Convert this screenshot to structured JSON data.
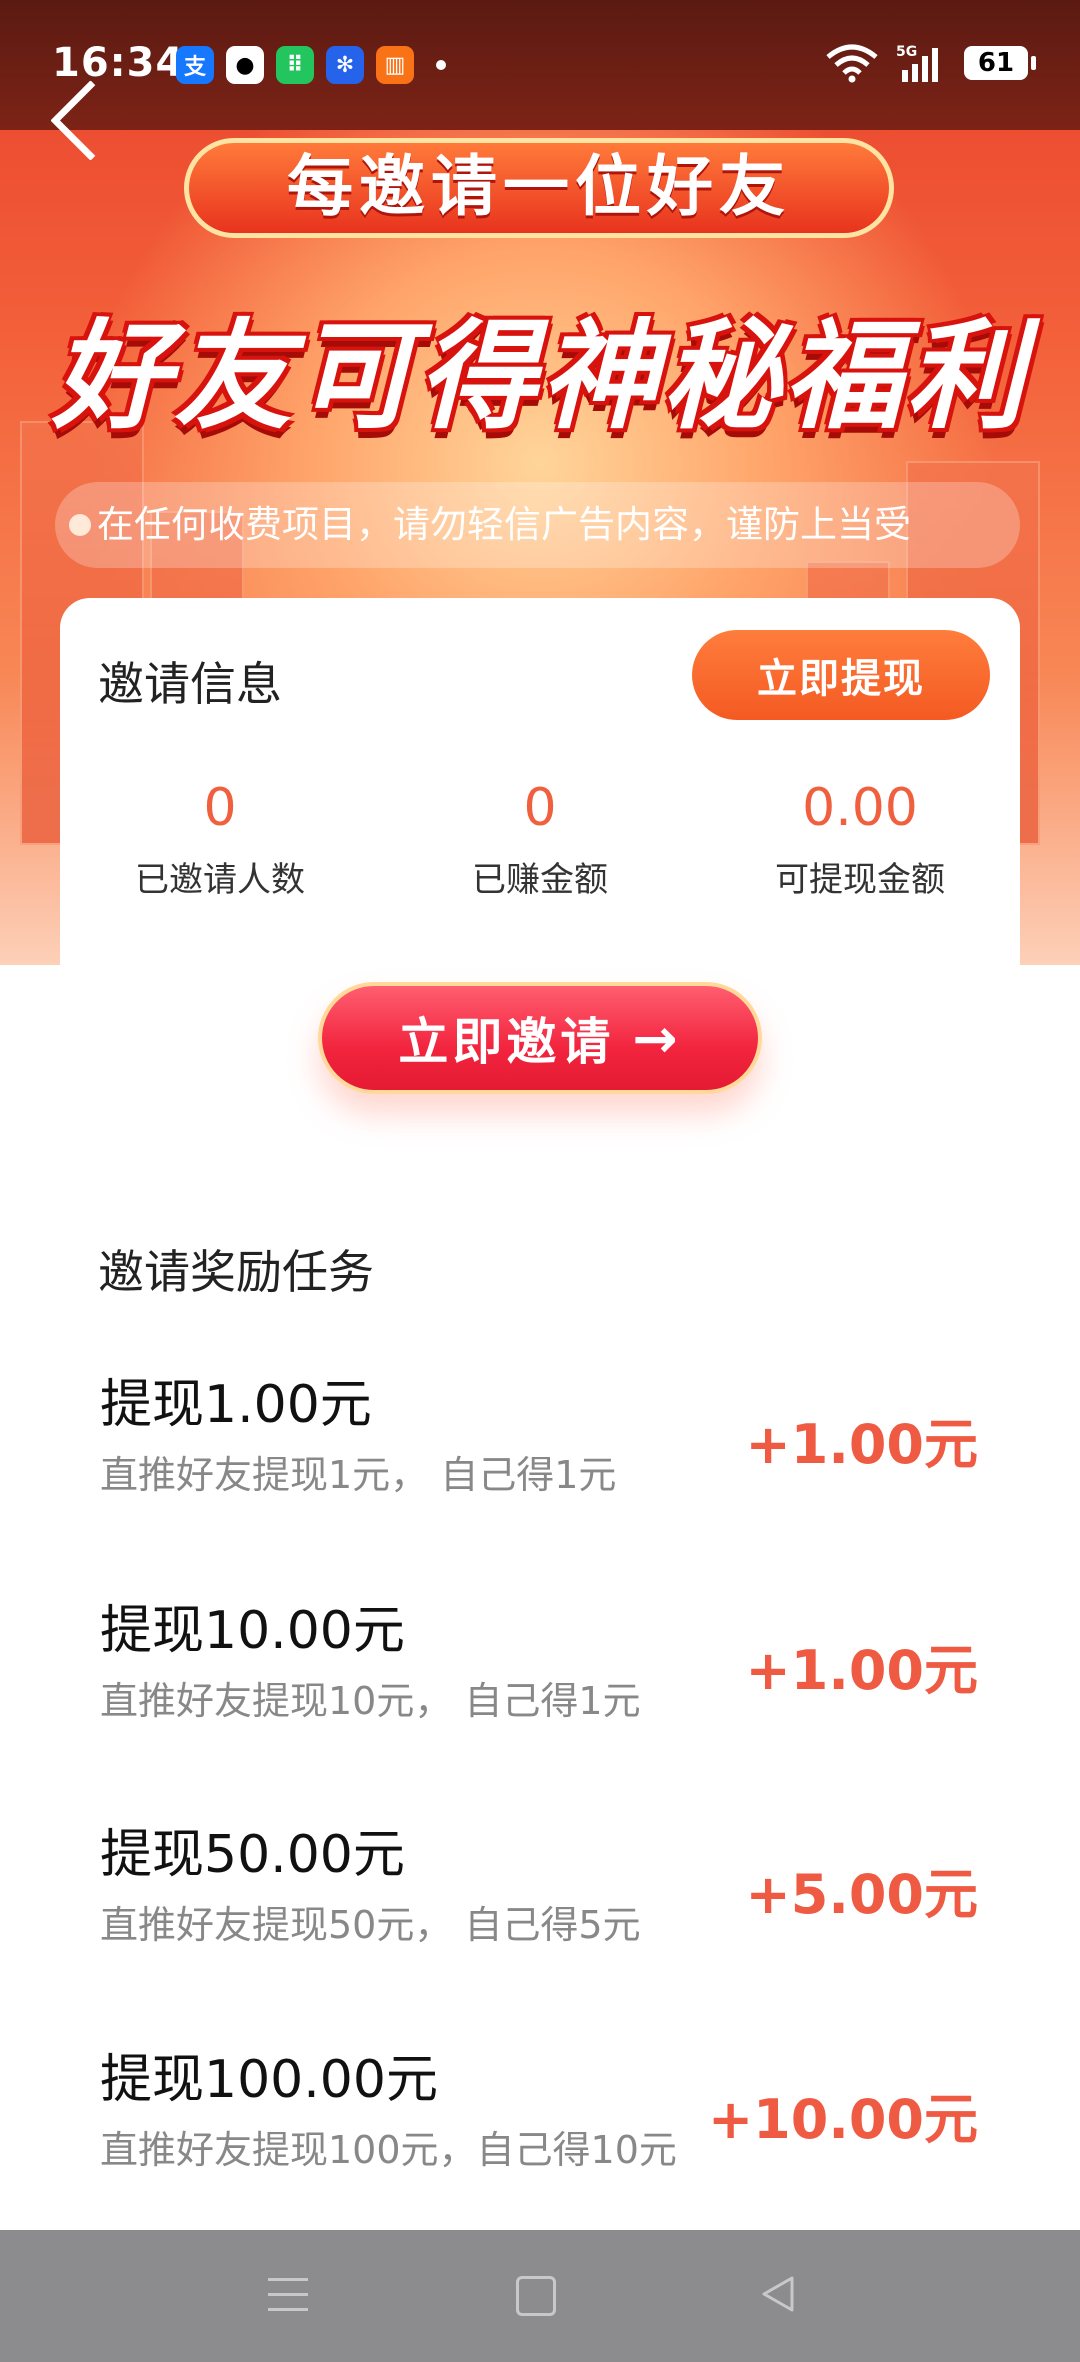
{
  "status_bar": {
    "time": "16:34",
    "network": "5G",
    "battery": "61"
  },
  "hero": {
    "subtitle": "每邀请一位好友",
    "title": "好友可得神秘福利",
    "notice": "在任何收费项目，请勿轻信广告内容，谨防上当受"
  },
  "invite_info": {
    "title": "邀请信息",
    "withdraw_button": "立即提现",
    "stats": [
      {
        "value": "0",
        "label": "已邀请人数"
      },
      {
        "value": "0",
        "label": "已赚金额"
      },
      {
        "value": "0.00",
        "label": "可提现金额"
      }
    ]
  },
  "invite_button": {
    "label": "立即邀请",
    "arrow": "→"
  },
  "tasks": {
    "title": "邀请奖励任务",
    "items": [
      {
        "title": "提现1.00元",
        "desc": "直推好友提现1元， 自己得1元",
        "reward": "+1.00元"
      },
      {
        "title": "提现10.00元",
        "desc": "直推好友提现10元， 自己得1元",
        "reward": "+1.00元"
      },
      {
        "title": "提现50.00元",
        "desc": "直推好友提现50元， 自己得5元",
        "reward": "+5.00元"
      },
      {
        "title": "提现100.00元",
        "desc": "直推好友提现100元，自己得10元",
        "reward": "+10.00元"
      }
    ]
  },
  "colors": {
    "accent": "#f45a22",
    "reward": "#ef5a43",
    "invite": "#f2243e"
  }
}
